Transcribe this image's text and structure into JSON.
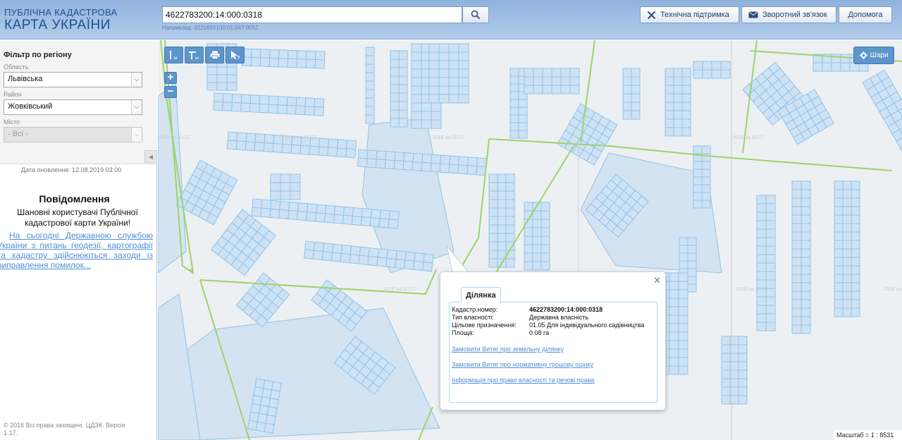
{
  "header": {
    "logo_line1": "ПУБЛІЧНА КАДАСТРОВА",
    "logo_line2": "КАРТА УКРАЇНИ",
    "search_value": "4622783200:14:000:0318",
    "search_hint": "Наприклад: 3221655100:01:047:0052",
    "buttons": {
      "support": "Технічна підтримка",
      "feedback": "Зворотний зв'язок",
      "help": "Допомога"
    }
  },
  "sidebar": {
    "filter_title": "Фільтр по регіону",
    "oblast_label": "Область",
    "oblast_value": "Львівська",
    "raion_label": "Район",
    "raion_value": "Жовківський",
    "city_label": "Місто",
    "city_value": "- Всі -",
    "update_date": "Дата оновлення: 12.08.2019 03:00",
    "news_title": "Повідомлення",
    "news_body": "Шановні користувачі Публічної кадастрової карти України!",
    "news_link": "На сьогодні Державною службою України з питань геодезії, картографії та кадастру здійснюються заходи із виправлення помилок...",
    "copyright": "© 2016 Всі права захищені. ЦДЗК. Версія 1.17."
  },
  "map": {
    "layers_label": "Шари",
    "scale_text": "Масштаб = 1 : 8531",
    "watermark": "2018 ua.SLCC",
    "tools": [
      "ruler-icon",
      "area-icon",
      "print-icon",
      "identify-icon"
    ],
    "colors": {
      "parcel_fill": "#cfe2f4",
      "parcel_stroke": "#8cc3ea",
      "boundary": "#9dd36a",
      "background": "#edf0f3",
      "accent": "#5d95cd"
    }
  },
  "popup": {
    "tab": "Ділянка",
    "rows": [
      {
        "key": "Кадастр.номер:",
        "value": "4622783200:14:000:0318"
      },
      {
        "key": "Тип власності:",
        "value": "Державна власність"
      },
      {
        "key": "Цільове призначення:",
        "value": "01.05 Для індивідуального садівництва"
      },
      {
        "key": "Площа:",
        "value": "0.08 га"
      }
    ],
    "links": [
      "Замовити Витяг про земельну ділянку",
      "Замовити Витяг про нормативну грошову оцінку",
      "Інформація про право власності та речові права"
    ]
  }
}
